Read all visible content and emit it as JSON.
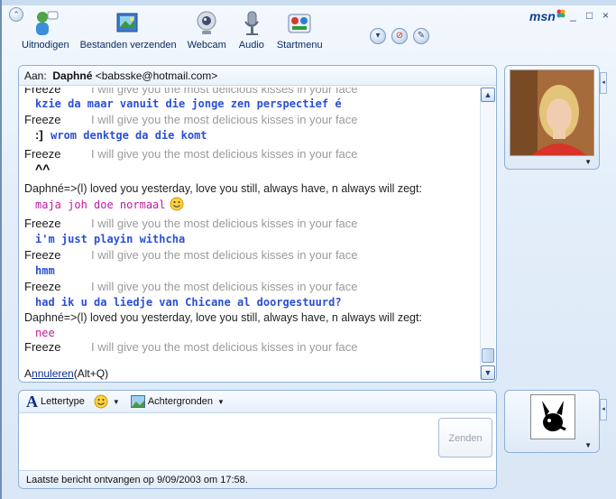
{
  "toolbar": {
    "invite": "Uitnodigen",
    "send_files": "Bestanden verzenden",
    "webcam": "Webcam",
    "audio": "Audio",
    "startmenu": "Startmenu"
  },
  "brand": "msn",
  "window_controls": {
    "minimize": "_",
    "maximize": "□",
    "close": "×"
  },
  "conversation": {
    "to_label": "Aan:",
    "to_name": "Daphné",
    "to_email": "<babsske@hotmail.com>",
    "messages": [
      {
        "type": "sender",
        "name": "Freeze",
        "said": "I will give you the most delicious kisses in your face"
      },
      {
        "type": "msg-blue",
        "text": "kzie da maar vanuit die jonge zen perspectief é"
      },
      {
        "type": "sender",
        "name": "Freeze",
        "said": "I will give you the most delicious kisses in your face"
      },
      {
        "type": "msg-blue",
        "text": "wrom denktge da die komt"
      },
      {
        "type": "sender",
        "name": "Freeze",
        "said": "I will give you the most delicious kisses in your face"
      },
      {
        "type": "daphne",
        "text": "Daphné=>(l) loved you yesterday, love you still, always have, n always will zegt:"
      },
      {
        "type": "msg-pink",
        "text": "maja joh doe normaal"
      },
      {
        "type": "sender",
        "name": "Freeze",
        "said": "I will give you the most delicious kisses in your face"
      },
      {
        "type": "msg-blue",
        "text": "i'm just playin withcha"
      },
      {
        "type": "sender",
        "name": "Freeze",
        "said": "I will give you the most delicious kisses in your face"
      },
      {
        "type": "msg-blue",
        "text": "hmm"
      },
      {
        "type": "sender",
        "name": "Freeze",
        "said": "I will give you the most delicious kisses in your face"
      },
      {
        "type": "msg-blue",
        "text": "had ik u da liedje van Chicane al doorgestuurd?"
      },
      {
        "type": "daphne",
        "text": "Daphné=>(l) loved you yesterday, love you still, always have, n always will zegt:"
      },
      {
        "type": "msg-pink",
        "text": "nee"
      },
      {
        "type": "sender",
        "name": "Freeze",
        "said": "I will give you the most delicious kisses in your face"
      }
    ],
    "cancel_prefix": "A",
    "cancel_link": "nnuleren",
    "cancel_suffix": "(Alt+Q)"
  },
  "compose": {
    "font_label": "Lettertype",
    "backgrounds_label": "Achtergronden",
    "send_label": "Zenden"
  },
  "status": "Laatste bericht ontvangen op 9/09/2003 om 17:58.",
  "colors": {
    "accent": "#2a4fd6",
    "pink": "#c21a9e",
    "border": "#8fb0d6"
  }
}
